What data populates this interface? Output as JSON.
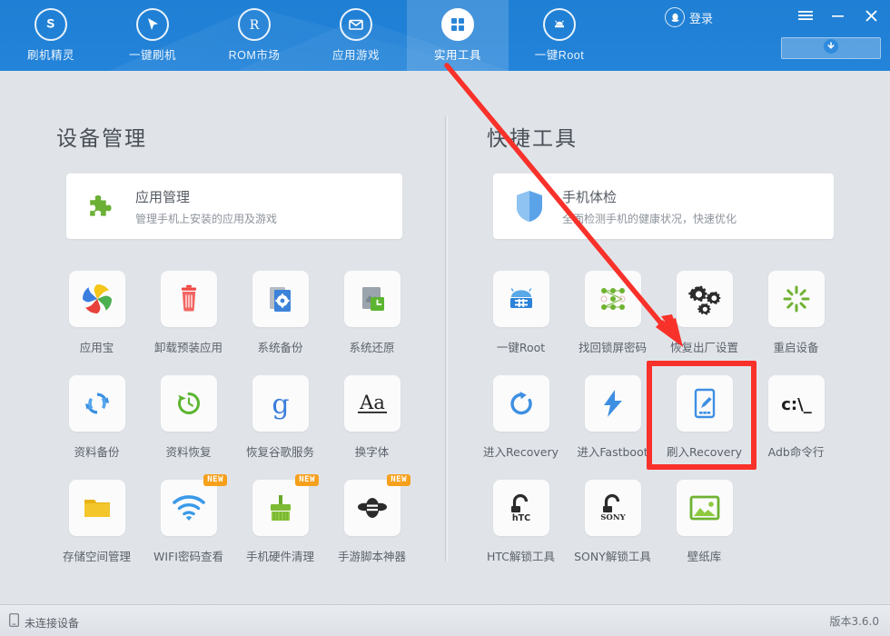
{
  "header": {
    "nav": [
      {
        "label": "刷机精灵",
        "icon": "s-logo-icon",
        "active": false
      },
      {
        "label": "一键刷机",
        "icon": "cursor-icon",
        "active": false
      },
      {
        "label": "ROM市场",
        "icon": "rom-r-icon",
        "active": false
      },
      {
        "label": "应用游戏",
        "icon": "mail-icon",
        "active": false
      },
      {
        "label": "实用工具",
        "icon": "grid-squares-icon",
        "active": true
      },
      {
        "label": "一键Root",
        "icon": "android-root-icon",
        "active": false
      }
    ],
    "login_label": "登录",
    "window_buttons": [
      {
        "name": "menu",
        "glyph": "☰"
      },
      {
        "name": "minimize",
        "glyph": "—"
      },
      {
        "name": "close",
        "glyph": "✕"
      }
    ],
    "download_button": {
      "icon": "download-circle-icon",
      "label": ""
    },
    "accent_color": "#2181d6"
  },
  "left": {
    "title": "设备管理",
    "banner": {
      "icon": "puzzle-piece-icon",
      "title": "应用管理",
      "subtitle": "管理手机上安装的应用及游戏"
    },
    "tools": [
      {
        "label": "应用宝",
        "icon": "yingyongbao-icon",
        "new": false
      },
      {
        "label": "卸载预装应用",
        "icon": "trash-can-icon",
        "new": false
      },
      {
        "label": "系统备份",
        "icon": "system-backup-icon",
        "new": false
      },
      {
        "label": "系统还原",
        "icon": "system-restore-icon",
        "new": false
      },
      {
        "label": "资料备份",
        "icon": "sync-arrows-icon",
        "new": false
      },
      {
        "label": "资料恢复",
        "icon": "clock-restore-icon",
        "new": false
      },
      {
        "label": "恢复谷歌服务",
        "icon": "google-g-icon",
        "new": false
      },
      {
        "label": "换字体",
        "icon": "font-aa-icon",
        "new": false
      },
      {
        "label": "存储空间管理",
        "icon": "folder-icon",
        "new": false
      },
      {
        "label": "WIFI密码查看",
        "icon": "wifi-icon",
        "new": true
      },
      {
        "label": "手机硬件清理",
        "icon": "broom-icon",
        "new": true
      },
      {
        "label": "手游脚本神器",
        "icon": "bee-script-icon",
        "new": true
      }
    ]
  },
  "right": {
    "title": "快捷工具",
    "banner": {
      "icon": "shield-icon",
      "title": "手机体检",
      "subtitle": "全面检测手机的健康状况，快速优化"
    },
    "tools": [
      {
        "label": "一键Root",
        "icon": "android-root-box-icon",
        "new": false
      },
      {
        "label": "找回锁屏密码",
        "icon": "pattern-lock-icon",
        "new": false
      },
      {
        "label": "恢复出厂设置",
        "icon": "gears-icon",
        "new": false
      },
      {
        "label": "重启设备",
        "icon": "restart-burst-icon",
        "new": false
      },
      {
        "label": "进入Recovery",
        "icon": "refresh-circle-icon",
        "new": false
      },
      {
        "label": "进入Fastboot",
        "icon": "lightning-bolt-icon",
        "new": false
      },
      {
        "label": "刷入Recovery",
        "icon": "flash-device-icon",
        "new": false
      },
      {
        "label": "Adb命令行",
        "icon": "cmd-prompt-icon",
        "new": false
      },
      {
        "label": "HTC解锁工具",
        "icon": "htc-unlock-icon",
        "new": false
      },
      {
        "label": "SONY解锁工具",
        "icon": "sony-unlock-icon",
        "new": false
      },
      {
        "label": "壁纸库",
        "icon": "wallpaper-picture-icon",
        "new": false
      }
    ]
  },
  "annotations": {
    "arrow_color": "#f8312a",
    "highlight_color": "#f8312a",
    "highlighted_item": "刷入Recovery"
  },
  "statusbar": {
    "device_icon": "phone-icon",
    "device_status": "未连接设备",
    "version": "版本3.6.0"
  }
}
